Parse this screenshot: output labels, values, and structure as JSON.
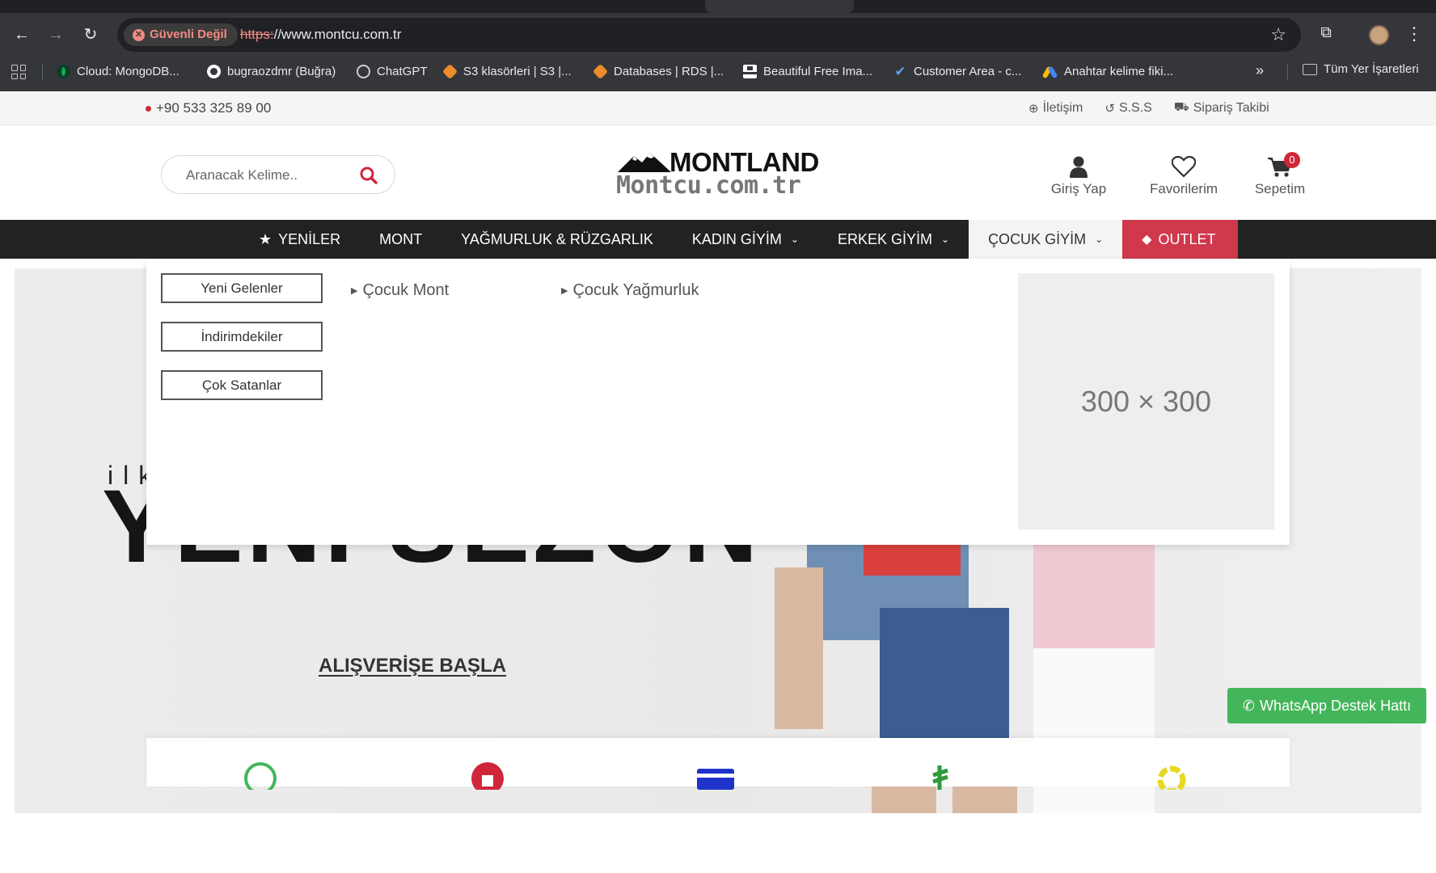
{
  "browser": {
    "security_chip": "Güvenli Değil",
    "url_scheme": "https:",
    "url_rest": "//www.montcu.com.tr",
    "bookmarks": [
      {
        "label": "Cloud: MongoDB...",
        "icon": "mongodb-leaf-icon",
        "color": "#13aa52"
      },
      {
        "label": "bugraozdmr (Buğra)",
        "icon": "github-icon",
        "color": "#ffffff"
      },
      {
        "label": "ChatGPT",
        "icon": "chatgpt-icon",
        "color": "#cfcfcf"
      },
      {
        "label": "S3 klasörleri | S3 |...",
        "icon": "aws-cube-icon",
        "color": "#ec8c2b"
      },
      {
        "label": "Databases | RDS |...",
        "icon": "aws-cube-icon",
        "color": "#ec8c2b"
      },
      {
        "label": "Beautiful Free Ima...",
        "icon": "unsplash-icon",
        "color": "#ffffff"
      },
      {
        "label": "Customer Area - c...",
        "icon": "check-icon",
        "color": "#5aa0e6"
      },
      {
        "label": "Anahtar kelime fiki...",
        "icon": "google-ads-icon",
        "color": "#4285f4"
      }
    ],
    "bookmarks_folder": "Tüm Yer İşaretleri"
  },
  "topbar": {
    "phone": "+90 533 325 89 00",
    "links": [
      "İletişim",
      "S.S.S",
      "Sipariş Takibi"
    ]
  },
  "header": {
    "search_placeholder": "Aranacak Kelime..",
    "logo_brand": "MONTLAND",
    "logo_domain": "Montcu.com.tr",
    "login": "Giriş Yap",
    "favorites": "Favorilerim",
    "cart": "Sepetim",
    "cart_count": "0"
  },
  "nav": {
    "items": [
      "YENİLER",
      "MONT",
      "YAĞMURLUK & RÜZGARLIK",
      "KADIN GİYİM",
      "ERKEK GİYİM",
      "ÇOCUK GİYİM",
      "OUTLET"
    ]
  },
  "mega": {
    "buttons": [
      "Yeni Gelenler",
      "İndirimdekiler",
      "Çok Satanlar"
    ],
    "links": [
      "Çocuk Mont",
      "Çocuk Yağmurluk"
    ],
    "placeholder": "300 × 300"
  },
  "hero": {
    "tagline": "ilk",
    "headline": "YENİ SEZON",
    "cta": "ALIŞVERİŞE BAŞLA"
  },
  "whatsapp": "WhatsApp Destek Hattı",
  "colors": {
    "accent_red": "#d0384c",
    "nav_bg": "#222222",
    "whatsapp_green": "#43b55a"
  }
}
